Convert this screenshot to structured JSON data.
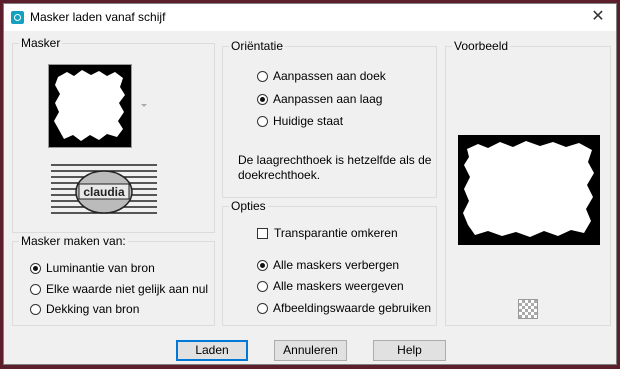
{
  "window": {
    "title": "Masker laden vanaf schijf"
  },
  "masker": {
    "label": "Masker",
    "thumbnail_icon": "mask-thumbnail",
    "watermark_text": "claudia"
  },
  "maker": {
    "label": "Masker maken van:",
    "options": [
      {
        "label": "Luminantie van bron",
        "selected": true
      },
      {
        "label": "Elke waarde niet gelijk aan nul",
        "selected": false
      },
      {
        "label": "Dekking van bron",
        "selected": false
      }
    ]
  },
  "orientatie": {
    "label": "Oriëntatie",
    "options": [
      {
        "label": "Aanpassen aan doek",
        "selected": false
      },
      {
        "label": "Aanpassen aan laag",
        "selected": true
      },
      {
        "label": "Huidige staat",
        "selected": false
      }
    ],
    "description": "De laagrechthoek is hetzelfde als de doekrechthoek."
  },
  "opties": {
    "label": "Opties",
    "invert_label": "Transparantie omkeren",
    "invert_checked": false,
    "options": [
      {
        "label": "Alle maskers verbergen",
        "selected": true
      },
      {
        "label": "Alle maskers weergeven",
        "selected": false
      },
      {
        "label": "Afbeeldingswaarde gebruiken",
        "selected": false
      }
    ]
  },
  "voorbeeld": {
    "label": "Voorbeeld",
    "icon": "checkerboard-icon"
  },
  "buttons": {
    "load": "Laden",
    "cancel": "Annuleren",
    "help": "Help"
  }
}
